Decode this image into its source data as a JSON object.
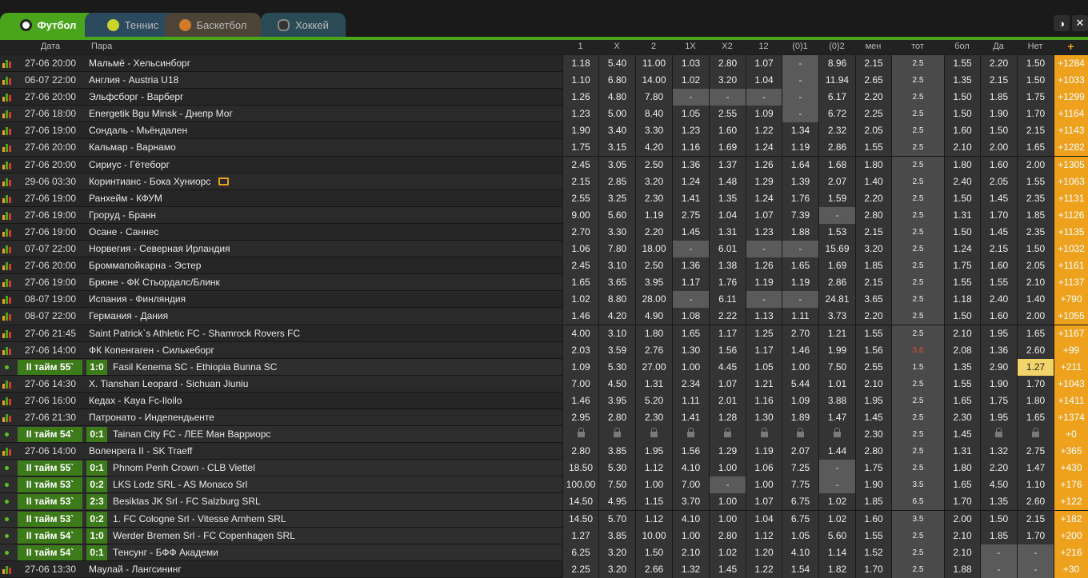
{
  "tabs": [
    {
      "label": "Футбол",
      "icon": "football-icon"
    },
    {
      "label": "Теннис",
      "icon": "tennis-ball-icon"
    },
    {
      "label": "Баскетбол",
      "icon": "basketball-icon"
    },
    {
      "label": "Хоккей",
      "icon": "hockey-puck-icon"
    }
  ],
  "toolbar": {
    "contrast_icon": "◑",
    "close_icon": "✕"
  },
  "header": {
    "date": "Дата",
    "pair": "Пара",
    "cols": [
      "1",
      "X",
      "2",
      "1X",
      "X2",
      "12",
      "(0)1",
      "(0)2",
      "мен",
      "тот",
      "бол",
      "Да",
      "Нет"
    ],
    "plus": "+"
  },
  "rows": [
    {
      "date": "27-06 20:00",
      "pair": "Мальмё - Хельсинборг",
      "odds": [
        "1.18",
        "5.40",
        "11.00",
        "1.03",
        "2.80",
        "1.07",
        "-",
        "8.96",
        "2.15",
        "2.5",
        "1.55",
        "2.20",
        "1.50"
      ],
      "plus": "+1284"
    },
    {
      "date": "06-07 22:00",
      "pair": "Англия - Austria U18",
      "odds": [
        "1.10",
        "6.80",
        "14.00",
        "1.02",
        "3.20",
        "1.04",
        "-",
        "11.94",
        "2.65",
        "2.5",
        "1.35",
        "2.15",
        "1.50"
      ],
      "plus": "+1033"
    },
    {
      "date": "27-06 20:00",
      "pair": "Эльфсборг - Варберг",
      "odds": [
        "1.26",
        "4.80",
        "7.80",
        "-",
        "-",
        "-",
        "-",
        "6.17",
        "2.20",
        "2.5",
        "1.50",
        "1.85",
        "1.75"
      ],
      "plus": "+1299"
    },
    {
      "date": "27-06 18:00",
      "pair": "Energetik Bgu Minsk - Днепр Мог",
      "odds": [
        "1.23",
        "5.00",
        "8.40",
        "1.05",
        "2.55",
        "1.09",
        "-",
        "6.72",
        "2.25",
        "2.5",
        "1.50",
        "1.90",
        "1.70"
      ],
      "plus": "+1164"
    },
    {
      "date": "27-06 19:00",
      "pair": "Сондаль - Мьёндален",
      "odds": [
        "1.90",
        "3.40",
        "3.30",
        "1.23",
        "1.60",
        "1.22",
        "1.34",
        "2.32",
        "2.05",
        "2.5",
        "1.60",
        "1.50",
        "2.15"
      ],
      "plus": "+1143"
    },
    {
      "date": "27-06 20:00",
      "pair": "Кальмар - Варнамо",
      "odds": [
        "1.75",
        "3.15",
        "4.20",
        "1.16",
        "1.69",
        "1.24",
        "1.19",
        "2.86",
        "1.55",
        "2.5",
        "2.10",
        "2.00",
        "1.65"
      ],
      "plus": "+1282"
    },
    {
      "date": "27-06 20:00",
      "pair": "Сириус - Гётеборг",
      "odds": [
        "2.45",
        "3.05",
        "2.50",
        "1.36",
        "1.37",
        "1.26",
        "1.64",
        "1.68",
        "1.80",
        "2.5",
        "1.80",
        "1.60",
        "2.00"
      ],
      "plus": "+1305"
    },
    {
      "date": "29-06 03:30",
      "pair": "Коринтианс - Бока Хуниорс",
      "tv": true,
      "odds": [
        "2.15",
        "2.85",
        "3.20",
        "1.24",
        "1.48",
        "1.29",
        "1.39",
        "2.07",
        "1.40",
        "2.5",
        "2.40",
        "2.05",
        "1.55"
      ],
      "plus": "+1063"
    },
    {
      "date": "27-06 19:00",
      "pair": "Ранхейм - КФУМ",
      "odds": [
        "2.55",
        "3.25",
        "2.30",
        "1.41",
        "1.35",
        "1.24",
        "1.76",
        "1.59",
        "2.20",
        "2.5",
        "1.50",
        "1.45",
        "2.35"
      ],
      "plus": "+1131"
    },
    {
      "date": "27-06 19:00",
      "pair": "Грорyд - Бранн",
      "odds": [
        "9.00",
        "5.60",
        "1.19",
        "2.75",
        "1.04",
        "1.07",
        "7.39",
        "-",
        "2.80",
        "2.5",
        "1.31",
        "1.70",
        "1.85"
      ],
      "plus": "+1126"
    },
    {
      "date": "27-06 19:00",
      "pair": "Осане - Саннес",
      "odds": [
        "2.70",
        "3.30",
        "2.20",
        "1.45",
        "1.31",
        "1.23",
        "1.88",
        "1.53",
        "2.15",
        "2.5",
        "1.50",
        "1.45",
        "2.35"
      ],
      "plus": "+1135"
    },
    {
      "date": "07-07 22:00",
      "pair": "Норвегия - Северная Ирландия",
      "odds": [
        "1.06",
        "7.80",
        "18.00",
        "-",
        "6.01",
        "-",
        "-",
        "15.69",
        "3.20",
        "2.5",
        "1.24",
        "2.15",
        "1.50"
      ],
      "plus": "+1032"
    },
    {
      "date": "27-06 20:00",
      "pair": "Броммапойкарна - Эстер",
      "odds": [
        "2.45",
        "3.10",
        "2.50",
        "1.36",
        "1.38",
        "1.26",
        "1.65",
        "1.69",
        "1.85",
        "2.5",
        "1.75",
        "1.60",
        "2.05"
      ],
      "plus": "+1161"
    },
    {
      "date": "27-06 19:00",
      "pair": "Брюне - ФК Стьордалс/Блинк",
      "odds": [
        "1.65",
        "3.65",
        "3.95",
        "1.17",
        "1.76",
        "1.19",
        "1.19",
        "2.86",
        "2.15",
        "2.5",
        "1.55",
        "1.55",
        "2.10"
      ],
      "plus": "+1137"
    },
    {
      "date": "08-07 19:00",
      "pair": "Испания - Финляндия",
      "odds": [
        "1.02",
        "8.80",
        "28.00",
        "-",
        "6.11",
        "-",
        "-",
        "24.81",
        "3.65",
        "2.5",
        "1.18",
        "2.40",
        "1.40"
      ],
      "plus": "+790"
    },
    {
      "date": "08-07 22:00",
      "pair": "Германия - Дания",
      "odds": [
        "1.46",
        "4.20",
        "4.90",
        "1.08",
        "2.22",
        "1.13",
        "1.11",
        "3.73",
        "2.20",
        "2.5",
        "1.50",
        "1.60",
        "2.00"
      ],
      "plus": "+1055"
    },
    {
      "date": "27-06 21:45",
      "pair": "Saint Patrick`s Athletic FC - Shamrock Rovers FC",
      "odds": [
        "4.00",
        "3.10",
        "1.80",
        "1.65",
        "1.17",
        "1.25",
        "2.70",
        "1.21",
        "1.55",
        "2.5",
        "2.10",
        "1.95",
        "1.65"
      ],
      "plus": "+1167"
    },
    {
      "date": "27-06 14:00",
      "pair": "ФК Копенгаген - Силькеборг",
      "odds": [
        "2.03",
        "3.59",
        "2.76",
        "1.30",
        "1.56",
        "1.17",
        "1.46",
        "1.99",
        "1.56",
        "3.6",
        "2.08",
        "1.36",
        "2.60"
      ],
      "plus": "+99",
      "totred": true
    },
    {
      "live": "II тайм 55`",
      "score": "1:0",
      "pair": "Fasil Kenema SC - Ethiopia Bunna SC",
      "odds": [
        "1.09",
        "5.30",
        "27.00",
        "1.00",
        "4.45",
        "1.05",
        "1.00",
        "7.50",
        "2.55",
        "1.5",
        "1.35",
        "2.90",
        "1.27"
      ],
      "plus": "+211",
      "hl": 12
    },
    {
      "date": "27-06 14:30",
      "pair": "X. Tianshan Leopard - Sichuan Jiuniu",
      "odds": [
        "7.00",
        "4.50",
        "1.31",
        "2.34",
        "1.07",
        "1.21",
        "5.44",
        "1.01",
        "2.10",
        "2.5",
        "1.55",
        "1.90",
        "1.70"
      ],
      "plus": "+1043"
    },
    {
      "date": "27-06 16:00",
      "pair": "Кедах - Kaya Fc-Iloilo",
      "odds": [
        "1.46",
        "3.95",
        "5.20",
        "1.11",
        "2.01",
        "1.16",
        "1.09",
        "3.88",
        "1.95",
        "2.5",
        "1.65",
        "1.75",
        "1.80"
      ],
      "plus": "+1411"
    },
    {
      "date": "27-06 21:30",
      "pair": "Патронато - Индепендьенте",
      "odds": [
        "2.95",
        "2.80",
        "2.30",
        "1.41",
        "1.28",
        "1.30",
        "1.89",
        "1.47",
        "1.45",
        "2.5",
        "2.30",
        "1.95",
        "1.65"
      ],
      "plus": "+1374"
    },
    {
      "live": "II тайм 54`",
      "score": "0:1",
      "pair": "Tainan City FC - ЛЕЕ Ман Варриорс",
      "odds": [
        "L",
        "L",
        "L",
        "L",
        "L",
        "L",
        "L",
        "L",
        "2.30",
        "2.5",
        "1.45",
        "L",
        "L"
      ],
      "plus": "+0"
    },
    {
      "date": "27-06 14:00",
      "pair": "Воленрега II - SK Traeff",
      "odds": [
        "2.80",
        "3.85",
        "1.95",
        "1.56",
        "1.29",
        "1.19",
        "2.07",
        "1.44",
        "2.80",
        "2.5",
        "1.31",
        "1.32",
        "2.75"
      ],
      "plus": "+365"
    },
    {
      "live": "II тайм 55`",
      "score": "0:1",
      "pair": "Phnom Penh Crown - CLB Viettel",
      "odds": [
        "18.50",
        "5.30",
        "1.12",
        "4.10",
        "1.00",
        "1.06",
        "7.25",
        "-",
        "1.75",
        "2.5",
        "1.80",
        "2.20",
        "1.47"
      ],
      "plus": "+430"
    },
    {
      "live": "II тайм 53`",
      "score": "0:2",
      "pair": "LKS Lodz SRL - AS Monaco Srl",
      "odds": [
        "100.00",
        "7.50",
        "1.00",
        "7.00",
        "-",
        "1.00",
        "7.75",
        "-",
        "1.90",
        "3.5",
        "1.65",
        "4.50",
        "1.10"
      ],
      "plus": "+176"
    },
    {
      "live": "II тайм 53`",
      "score": "2:3",
      "pair": "Besiktas JK Srl - FC Salzburg SRL",
      "odds": [
        "14.50",
        "4.95",
        "1.15",
        "3.70",
        "1.00",
        "1.07",
        "6.75",
        "1.02",
        "1.85",
        "6.5",
        "1.70",
        "1.35",
        "2.60"
      ],
      "plus": "+122"
    },
    {
      "live": "II тайм 53`",
      "score": "0:2",
      "pair": "1. FC Cologne Srl - Vitesse Arnhem SRL",
      "odds": [
        "14.50",
        "5.70",
        "1.12",
        "4.10",
        "1.00",
        "1.04",
        "6.75",
        "1.02",
        "1.60",
        "3.5",
        "2.00",
        "1.50",
        "2.15"
      ],
      "plus": "+182"
    },
    {
      "live": "II тайм 54`",
      "score": "1:0",
      "pair": "Werder Bremen Srl - FC Copenhagen SRL",
      "odds": [
        "1.27",
        "3.85",
        "10.00",
        "1.00",
        "2.80",
        "1.12",
        "1.05",
        "5.60",
        "1.55",
        "2.5",
        "2.10",
        "1.85",
        "1.70"
      ],
      "plus": "+200"
    },
    {
      "live": "II тайм 54`",
      "score": "0:1",
      "pair": "Тенсунг - БФФ Академи",
      "odds": [
        "6.25",
        "3.20",
        "1.50",
        "2.10",
        "1.02",
        "1.20",
        "4.10",
        "1.14",
        "1.52",
        "2.5",
        "2.10",
        "-",
        "-"
      ],
      "plus": "+216"
    },
    {
      "date": "27-06 13:30",
      "pair": "Маулай - Лангсининг",
      "odds": [
        "2.25",
        "3.20",
        "2.66",
        "1.32",
        "1.45",
        "1.22",
        "1.54",
        "1.82",
        "1.70",
        "2.5",
        "1.88",
        "-",
        "-"
      ],
      "plus": "+30"
    }
  ]
}
